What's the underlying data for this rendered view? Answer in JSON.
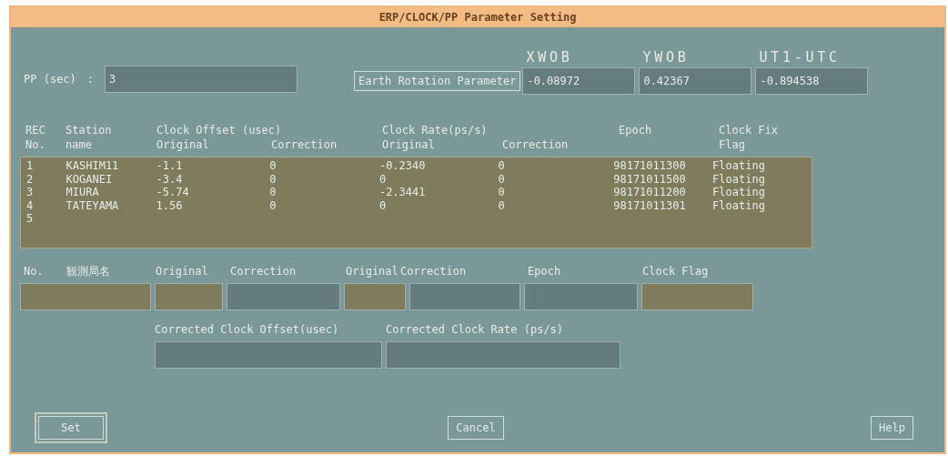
{
  "window": {
    "title": "ERP/CLOCK/PP Parameter Setting"
  },
  "pp": {
    "label": "PP (sec)",
    "colon": ":",
    "value": "3"
  },
  "erp": {
    "button": "Earth Rotation Parameter",
    "fields": [
      {
        "label": "XWOB",
        "value": "-0.08972"
      },
      {
        "label": "YWOB",
        "value": "0.42367"
      },
      {
        "label": "UT1-UTC",
        "value": "-0.894538"
      }
    ]
  },
  "table": {
    "header_top": [
      "REC",
      "Station",
      "Clock Offset (usec)",
      "Clock Rate(ps/s)",
      "Epoch",
      "Clock Fix"
    ],
    "header_bottom": [
      "No.",
      "name",
      "Original",
      "Correction",
      "Original",
      "Correction",
      "Flag"
    ],
    "rows": [
      [
        "1",
        "KASHIM11",
        "-1.1",
        "0",
        "-0.2340",
        "0",
        "98171011300",
        "Floating"
      ],
      [
        "2",
        "KOGANEI",
        "-3.4",
        "0",
        "0",
        "0",
        "98171011500",
        "Floating"
      ],
      [
        "3",
        "MIURA",
        "-5.74",
        "0",
        "-2.3441",
        "0",
        "98171011200",
        "Floating"
      ],
      [
        "4",
        "TATEYAMA",
        "1.56",
        "0",
        "0",
        "0",
        "98171011301",
        "Floating"
      ],
      [
        "5"
      ]
    ]
  },
  "entry": {
    "labels": [
      "No.",
      "観測局名",
      "Original",
      "Correction",
      "Original",
      "Correction",
      "Epoch",
      "Clock Flag"
    ],
    "fields": [
      {
        "editable": false
      },
      {
        "editable": false
      },
      {
        "editable": true
      },
      {
        "editable": false
      },
      {
        "editable": true
      },
      {
        "editable": true
      },
      {
        "editable": false
      }
    ]
  },
  "corrected": [
    {
      "label": "Corrected Clock Offset(usec)"
    },
    {
      "label": "Corrected Clock Rate (ps/s)"
    }
  ],
  "buttons": [
    {
      "label": "Set",
      "default": true
    },
    {
      "label": "Cancel",
      "default": false
    },
    {
      "label": "Help",
      "default": false
    }
  ]
}
